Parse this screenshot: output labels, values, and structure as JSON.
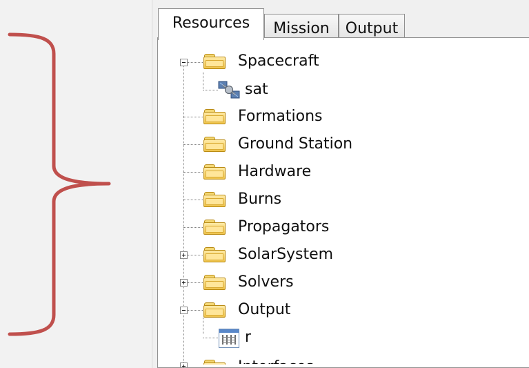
{
  "tabs": [
    {
      "label": "Resources"
    },
    {
      "label": "Mission"
    },
    {
      "label": "Output"
    }
  ],
  "tree": {
    "spacecraft": {
      "label": "Spacecraft",
      "child": "sat"
    },
    "formations": {
      "label": "Formations"
    },
    "ground_station": {
      "label": "Ground Station"
    },
    "hardware": {
      "label": "Hardware"
    },
    "burns": {
      "label": "Burns"
    },
    "propagators": {
      "label": "Propagators"
    },
    "solar_system": {
      "label": "SolarSystem"
    },
    "solvers": {
      "label": "Solvers"
    },
    "output": {
      "label": "Output",
      "child": "r"
    },
    "interfaces": {
      "label": "Interfaces"
    }
  },
  "colors": {
    "annotation_brace": "#c0504d",
    "folder": "#efc34b",
    "tree_border": "#8f8f8f"
  }
}
